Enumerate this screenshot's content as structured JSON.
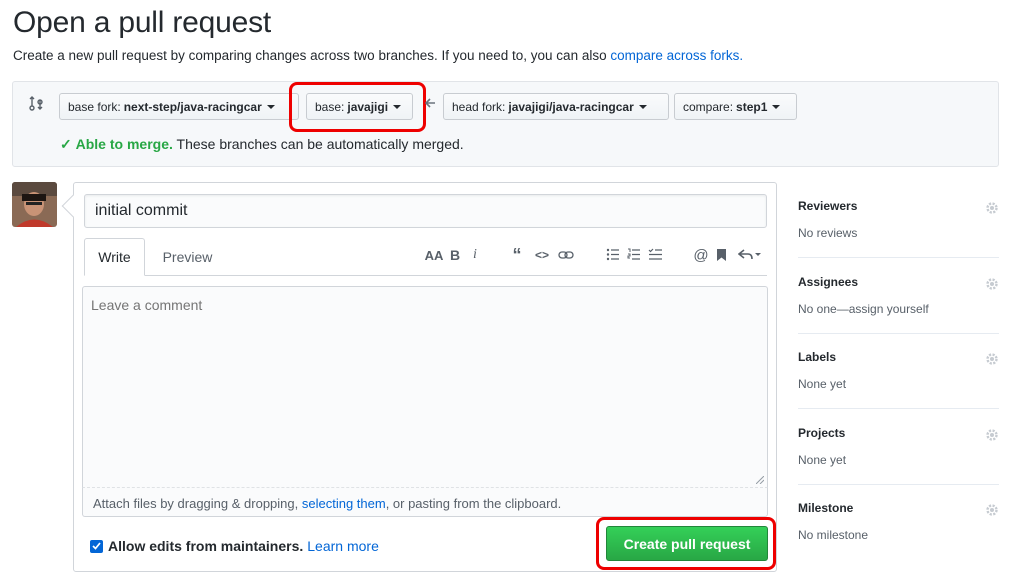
{
  "page": {
    "title": "Open a pull request",
    "subtitle_text": "Create a new pull request by comparing changes across two branches. If you need to, you can also ",
    "subtitle_link": "compare across forks."
  },
  "range": {
    "base_fork_prefix": "base fork:",
    "base_fork_value": "next-step/java-racingcar",
    "base_prefix": "base:",
    "base_value": "javajigi",
    "head_fork_prefix": "head fork:",
    "head_fork_value": "javajigi/java-racingcar",
    "compare_prefix": "compare:",
    "compare_value": "step1",
    "merge_ok": "Able to merge.",
    "merge_text": "These branches can be automatically merged."
  },
  "form": {
    "title_value": "initial commit",
    "tab_write": "Write",
    "tab_preview": "Preview",
    "toolbar": {
      "header": "AA",
      "bold": "B",
      "italic": "i",
      "quote": "“",
      "code": "<>"
    },
    "comment_placeholder": "Leave a comment",
    "attach_pre": "Attach files by dragging & dropping, ",
    "attach_link": "selecting them",
    "attach_post": ", or pasting from the clipboard.",
    "allow_edits_label": "Allow edits from maintainers.",
    "learn_more": "Learn more",
    "create_button": "Create pull request"
  },
  "sidebar": [
    {
      "title": "Reviewers",
      "value": "No reviews"
    },
    {
      "title": "Assignees",
      "value": "No one—assign yourself"
    },
    {
      "title": "Labels",
      "value": "None yet"
    },
    {
      "title": "Projects",
      "value": "None yet"
    },
    {
      "title": "Milestone",
      "value": "No milestone"
    }
  ],
  "colors": {
    "link": "#0366d6",
    "success": "#28a745",
    "highlight": "#e00000"
  }
}
